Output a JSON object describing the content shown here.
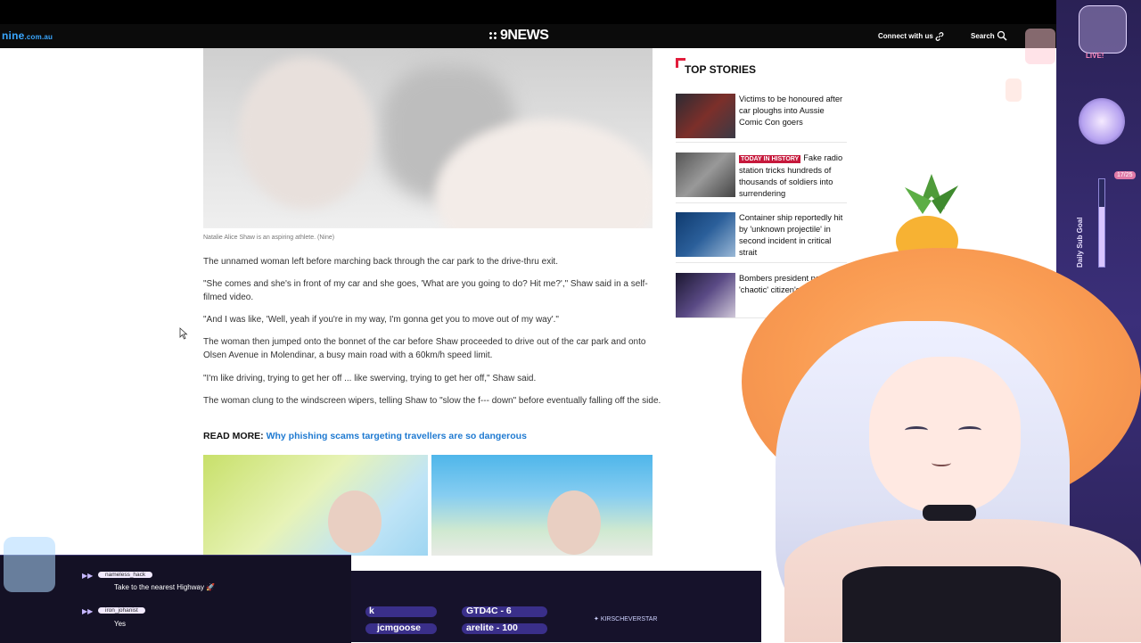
{
  "header": {
    "site_logo": "nine",
    "site_logo_sub": ".com.au",
    "news_logo": "9NEWS",
    "connect_label": "Connect with us",
    "search_label": "Search"
  },
  "article": {
    "caption": "Natalie Alice Shaw is an aspiring athlete. (Nine)",
    "paragraphs": [
      "The unnamed woman left before marching back through the car park to the drive-thru exit.",
      "\"She comes and she's in front of my car and she goes, 'What are you going to do? Hit me?',\" Shaw said in a self-filmed video.",
      "\"And I was like, 'Well, yeah if you're in my way, I'm gonna get you to move out of my way'.\"",
      "The woman then jumped onto the bonnet of the car before Shaw proceeded to drive out of the car park and onto Olsen Avenue in Molendinar, a busy main road with a 60km/h speed limit.",
      "\"I'm like driving, trying to get her off ... like swerving, trying to get her off,\" Shaw said.",
      "The woman clung to the windscreen wipers, telling Shaw to \"slow the f--- down\" before eventually falling off the side."
    ],
    "read_more_label": "READ MORE:",
    "read_more_link": "Why phishing scams targeting travellers are so dangerous"
  },
  "top_stories": {
    "title": "TOP STORIES",
    "accent": "#e21d3c",
    "items": [
      {
        "text": "Victims to be honoured after car ploughs into Aussie Comic Con goers",
        "badge": ""
      },
      {
        "text": "Fake radio station tricks hundreds of thousands of soldiers into surrendering",
        "badge": "TODAY IN HISTORY"
      },
      {
        "text": "Container ship reportedly hit by 'unknown projectile' in second incident in critical strait",
        "badge": ""
      },
      {
        "text": "Bombers president performs 'chaotic' citizen's arrest",
        "badge": ""
      }
    ]
  },
  "overlay": {
    "live_label": "LIVE!",
    "goal_label": "Daily Sub Goal",
    "goal_count": "17/25",
    "goal_progress": 0.68,
    "chat": [
      {
        "user": "nameless_hack",
        "message": "Take to the nearest Highway 🚀"
      },
      {
        "user": "iron_johanist",
        "message": "Yes"
      }
    ],
    "ticker": [
      "k",
      "GTD4C - 6",
      "jcmgoose",
      "arelite - 100"
    ],
    "twitter_handle": "KIRSCHEVERSTAR"
  }
}
